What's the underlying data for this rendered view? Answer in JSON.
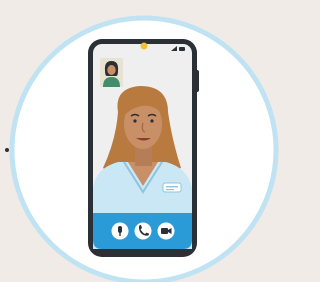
{
  "illustration": {
    "subject": "video-call",
    "colors": {
      "background": "#f0ebe7",
      "circle_fill": "#ffffff",
      "circle_ring": "#bfe3f3",
      "phone_body": "#2b2f36",
      "screen": "#efefef",
      "camera_dot": "#f2c230",
      "call_bar": "#2b9bd8",
      "scrubs": "#c9e7f5",
      "skin": "#c98f67",
      "hair": "#b97a3f",
      "pip_bg": "#e9e2d2",
      "pip_shirt": "#3f8f6a"
    },
    "controls": [
      {
        "name": "mic-button",
        "icon": "microphone-icon"
      },
      {
        "name": "end-call-button",
        "icon": "phone-icon"
      },
      {
        "name": "video-button",
        "icon": "video-camera-icon"
      }
    ]
  }
}
